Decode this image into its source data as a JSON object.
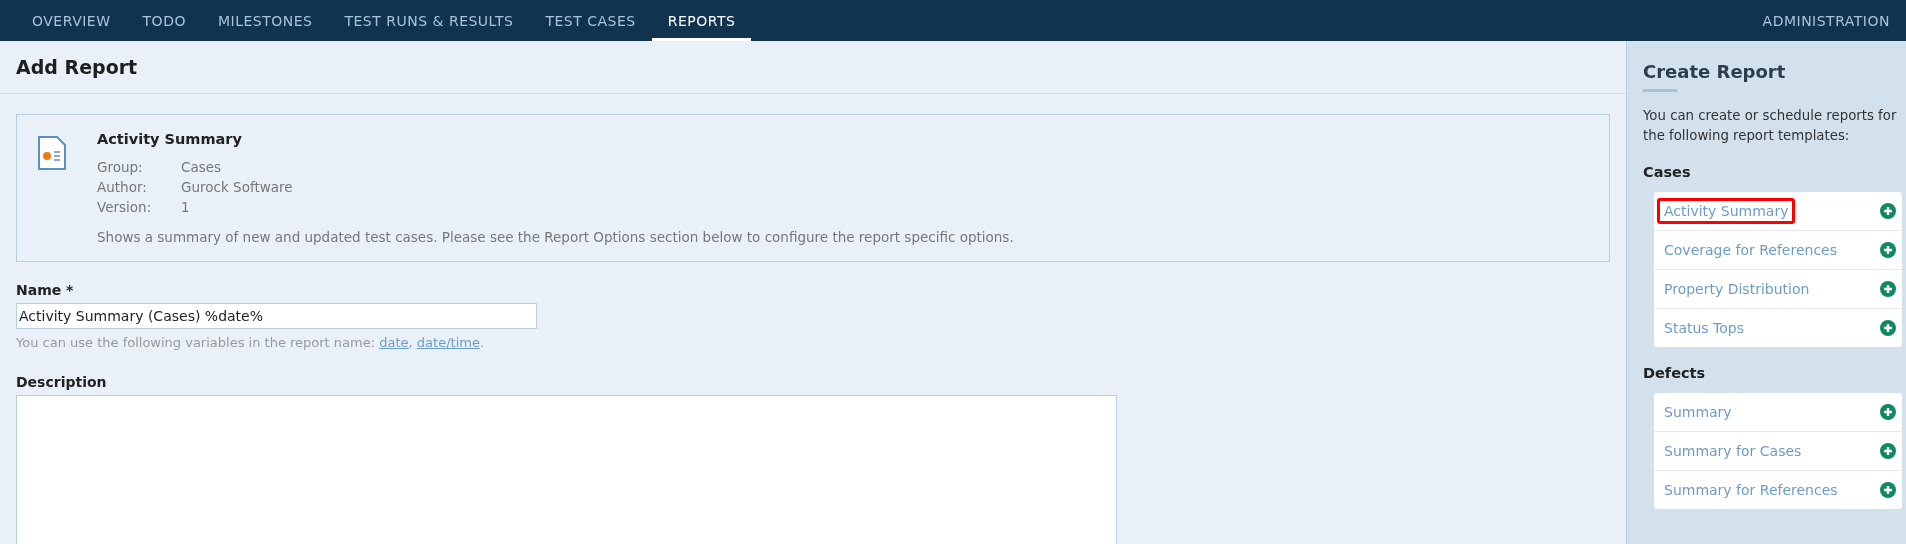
{
  "nav": {
    "tabs": [
      {
        "label": "OVERVIEW",
        "selected": false
      },
      {
        "label": "TODO",
        "selected": false
      },
      {
        "label": "MILESTONES",
        "selected": false
      },
      {
        "label": "TEST RUNS & RESULTS",
        "selected": false
      },
      {
        "label": "TEST CASES",
        "selected": false
      },
      {
        "label": "REPORTS",
        "selected": true
      }
    ],
    "admin": "ADMINISTRATION"
  },
  "page_title": "Add Report",
  "template": {
    "title": "Activity Summary",
    "meta": [
      {
        "label": "Group:",
        "value": "Cases"
      },
      {
        "label": "Author:",
        "value": "Gurock Software"
      },
      {
        "label": "Version:",
        "value": "1"
      }
    ],
    "description": "Shows a summary of new and updated test cases. Please see the Report Options section below to configure the report specific options."
  },
  "name_field": {
    "label": "Name *",
    "value": "Activity Summary (Cases) %date%",
    "hint": "You can use the following variables in the report name:",
    "links": [
      "date",
      "date/time"
    ],
    "link_separator": ",",
    "hint_end": "."
  },
  "description_field": {
    "label": "Description"
  },
  "sidebar": {
    "title": "Create Report",
    "intro": "You can create or schedule reports for the following report templates:",
    "groups": [
      {
        "title": "Cases",
        "items": [
          {
            "label": "Activity Summary",
            "highlighted": true
          },
          {
            "label": "Coverage for References",
            "highlighted": false
          },
          {
            "label": "Property Distribution",
            "highlighted": false
          },
          {
            "label": "Status Tops",
            "highlighted": false
          }
        ]
      },
      {
        "title": "Defects",
        "items": [
          {
            "label": "Summary",
            "highlighted": false
          },
          {
            "label": "Summary for Cases",
            "highlighted": false
          },
          {
            "label": "Summary for References",
            "highlighted": false
          }
        ]
      }
    ]
  }
}
